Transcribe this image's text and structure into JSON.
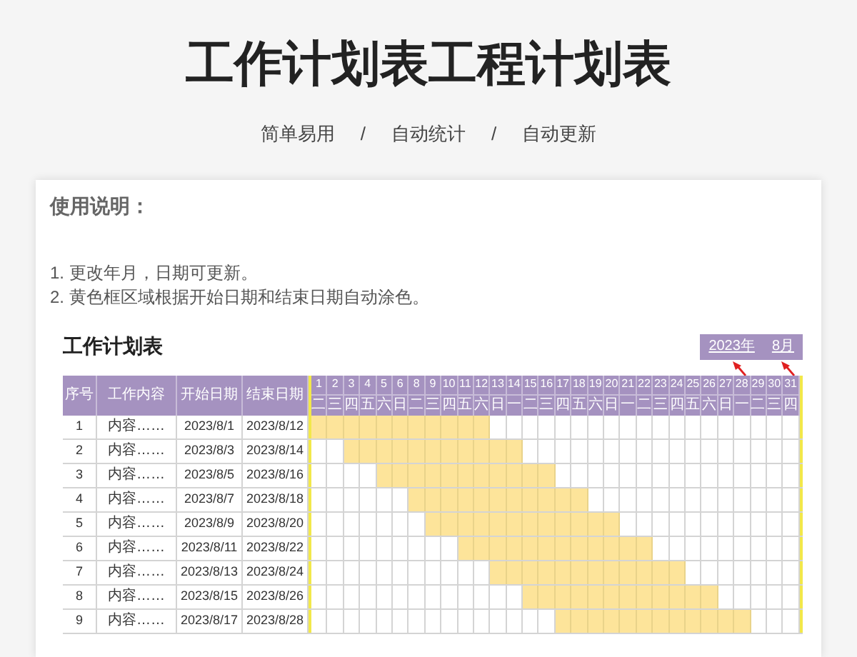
{
  "title": "工作计划表工程计划表",
  "subtitle": {
    "items": [
      "简单易用",
      "自动统计",
      "自动更新"
    ],
    "separator": "/"
  },
  "instructions": {
    "heading": "使用说明：",
    "items": [
      "1. 更改年月，日期可更新。",
      "2. 黄色框区域根据开始日期和结束日期自动涂色。"
    ]
  },
  "table": {
    "title": "工作计划表",
    "year": "2023年",
    "month": "8月",
    "columns": [
      "序号",
      "工作内容",
      "开始日期",
      "结束日期"
    ],
    "days": [
      {
        "day": "1",
        "weekday": "二"
      },
      {
        "day": "2",
        "weekday": "三"
      },
      {
        "day": "3",
        "weekday": "四"
      },
      {
        "day": "4",
        "weekday": "五"
      },
      {
        "day": "5",
        "weekday": "六"
      },
      {
        "day": "6",
        "weekday": "日"
      },
      {
        "day": "8",
        "weekday": "二"
      },
      {
        "day": "9",
        "weekday": "三"
      },
      {
        "day": "10",
        "weekday": "四"
      },
      {
        "day": "11",
        "weekday": "五"
      },
      {
        "day": "12",
        "weekday": "六"
      },
      {
        "day": "13",
        "weekday": "日"
      },
      {
        "day": "14",
        "weekday": "一"
      },
      {
        "day": "15",
        "weekday": "二"
      },
      {
        "day": "16",
        "weekday": "三"
      },
      {
        "day": "17",
        "weekday": "四"
      },
      {
        "day": "18",
        "weekday": "五"
      },
      {
        "day": "19",
        "weekday": "六"
      },
      {
        "day": "20",
        "weekday": "日"
      },
      {
        "day": "21",
        "weekday": "一"
      },
      {
        "day": "22",
        "weekday": "二"
      },
      {
        "day": "23",
        "weekday": "三"
      },
      {
        "day": "24",
        "weekday": "四"
      },
      {
        "day": "25",
        "weekday": "五"
      },
      {
        "day": "26",
        "weekday": "六"
      },
      {
        "day": "27",
        "weekday": "日"
      },
      {
        "day": "28",
        "weekday": "一"
      },
      {
        "day": "29",
        "weekday": "二"
      },
      {
        "day": "30",
        "weekday": "三"
      },
      {
        "day": "31",
        "weekday": "四"
      }
    ],
    "rows": [
      {
        "no": "1",
        "content": "内容……",
        "start": "2023/8/1",
        "end": "2023/8/12"
      },
      {
        "no": "2",
        "content": "内容……",
        "start": "2023/8/3",
        "end": "2023/8/14"
      },
      {
        "no": "3",
        "content": "内容……",
        "start": "2023/8/5",
        "end": "2023/8/16"
      },
      {
        "no": "4",
        "content": "内容……",
        "start": "2023/8/7",
        "end": "2023/8/18"
      },
      {
        "no": "5",
        "content": "内容……",
        "start": "2023/8/9",
        "end": "2023/8/20"
      },
      {
        "no": "6",
        "content": "内容……",
        "start": "2023/8/11",
        "end": "2023/8/22"
      },
      {
        "no": "7",
        "content": "内容……",
        "start": "2023/8/13",
        "end": "2023/8/24"
      },
      {
        "no": "8",
        "content": "内容……",
        "start": "2023/8/15",
        "end": "2023/8/26"
      },
      {
        "no": "9",
        "content": "内容……",
        "start": "2023/8/17",
        "end": "2023/8/28"
      }
    ]
  }
}
